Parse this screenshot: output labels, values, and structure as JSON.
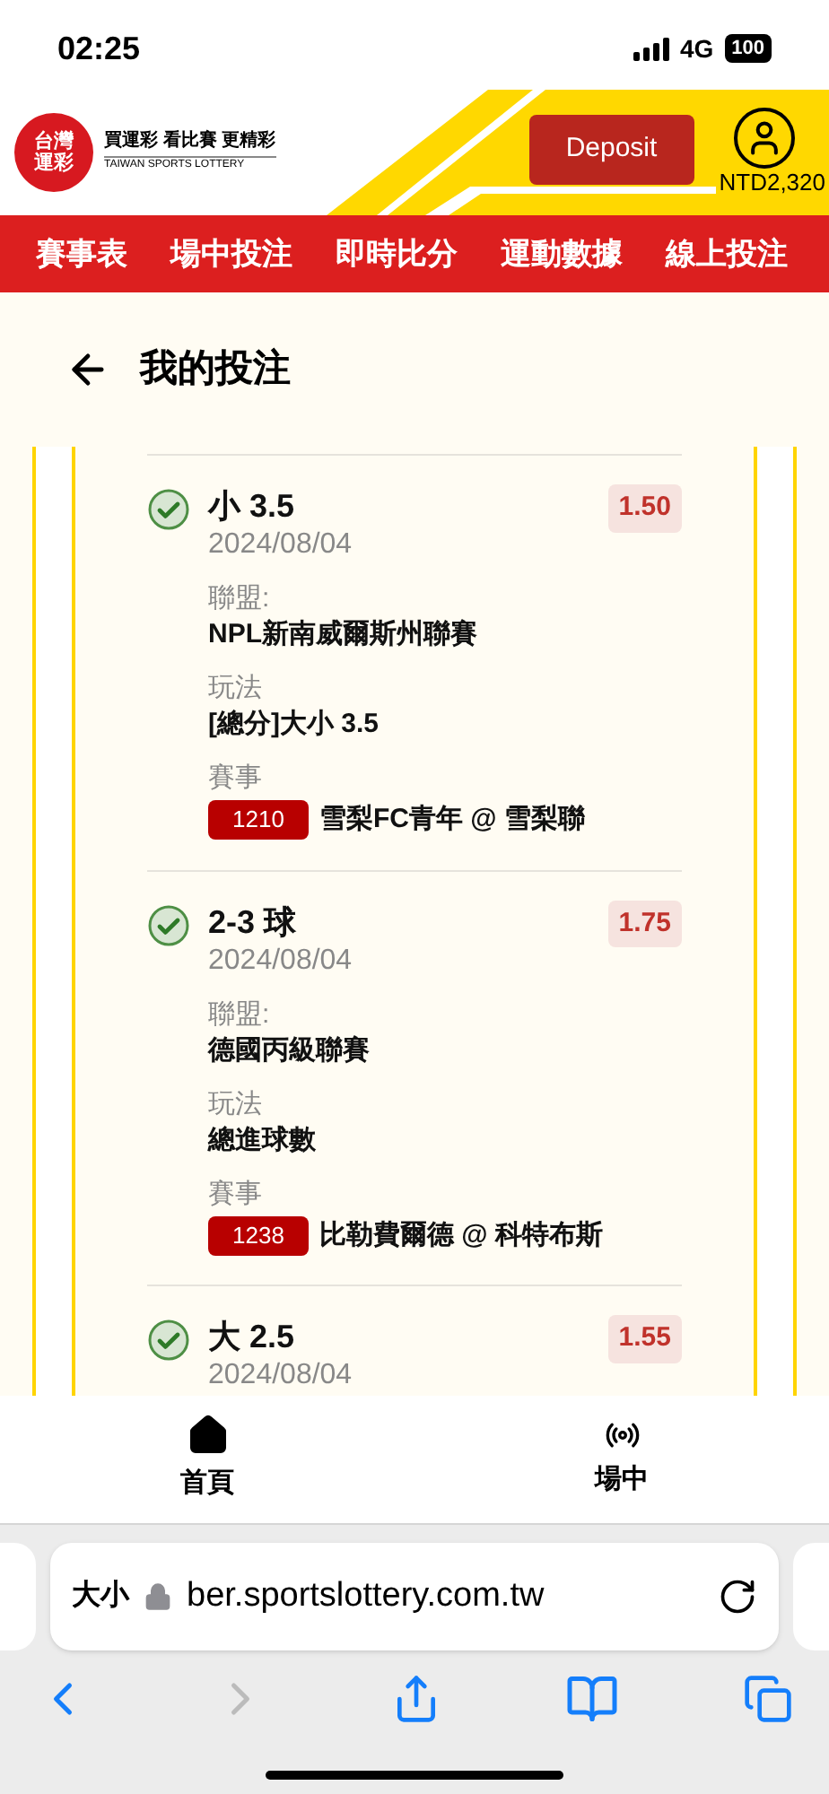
{
  "status_bar": {
    "time": "02:25",
    "network": "4G",
    "battery": "100"
  },
  "header": {
    "logo_text": [
      "台灣",
      "運彩"
    ],
    "tagline": "買運彩 看比賽 更精彩",
    "tagline_en": "TAIWAN SPORTS LOTTERY",
    "deposit_button": "Deposit",
    "balance": "NTD2,320"
  },
  "nav": [
    {
      "label": "賽事表"
    },
    {
      "label": "場中投注"
    },
    {
      "label": "即時比分"
    },
    {
      "label": "運動數據"
    },
    {
      "label": "線上投注"
    }
  ],
  "page_title": "我的投注",
  "bets": [
    {
      "selection": "小 3.5",
      "date": "2024/08/04",
      "odds": "1.50",
      "settled": true,
      "fields": [
        {
          "label": "聯盟:",
          "value": "NPL新南威爾斯州聯賽"
        },
        {
          "label": "玩法",
          "value": "[總分]大小 3.5"
        }
      ],
      "event_label": "賽事",
      "event_code": "1210",
      "event": "雪梨FC青年 @ 雪梨聯"
    },
    {
      "selection": "2-3 球",
      "date": "2024/08/04",
      "odds": "1.75",
      "settled": true,
      "fields": [
        {
          "label": "聯盟:",
          "value": "德國丙級聯賽"
        },
        {
          "label": "玩法",
          "value": "總進球數"
        }
      ],
      "event_label": "賽事",
      "event_code": "1238",
      "event": "比勒費爾德 @ 科特布斯"
    },
    {
      "selection": "大 2.5",
      "date": "2024/08/04",
      "odds": "1.55",
      "settled": true
    }
  ],
  "bottom_nav": [
    {
      "label": "首頁",
      "kind": "home"
    },
    {
      "label": "場中",
      "kind": "live"
    }
  ],
  "browser": {
    "text_size": "大小",
    "url": "ber.sportslottery.com.tw"
  }
}
